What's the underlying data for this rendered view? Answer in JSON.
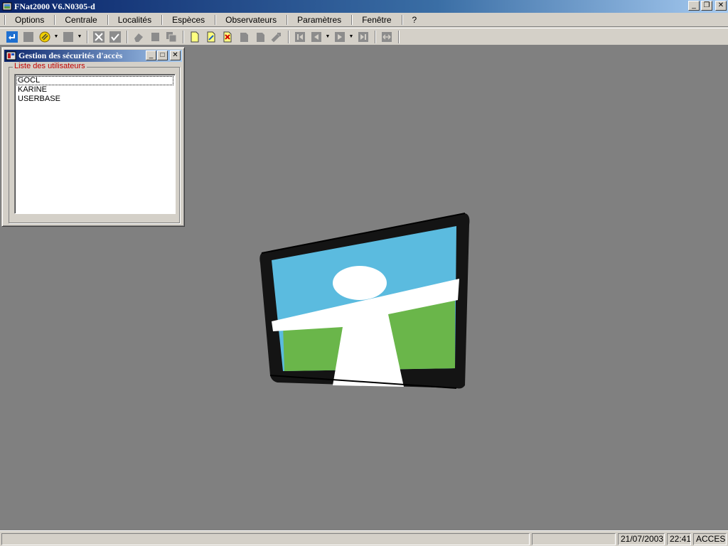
{
  "window": {
    "title": "FNat2000 V6.N0305-d"
  },
  "menu": [
    "Options",
    "Centrale",
    "Localités",
    "Espèces",
    "Observateurs",
    "Paramètres",
    "Fenêtre",
    "?"
  ],
  "child_window": {
    "title": "Gestion des sécurités d'accès",
    "group_label": "Liste des utilisateurs",
    "users": [
      "GOCL",
      "KARINE",
      "USERBASE"
    ]
  },
  "statusbar": {
    "main": "",
    "pane2": "",
    "date": "21/07/2003",
    "time": "22:41",
    "mode": "ACCESS"
  },
  "colors": {
    "titlebar": "#0a246a",
    "workspace": "#808080",
    "logo_sky": "#5bbbdf",
    "logo_grass": "#6ab64a",
    "group_label": "#c00000"
  }
}
